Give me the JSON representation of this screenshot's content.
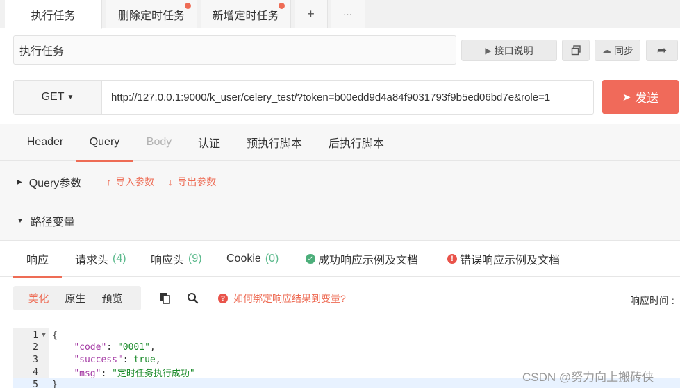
{
  "tabs": [
    {
      "label": "执行任务",
      "dot": false
    },
    {
      "label": "删除定时任务",
      "dot": true
    },
    {
      "label": "新增定时任务",
      "dot": true
    }
  ],
  "tab_add_glyph": "+",
  "tab_more_glyph": "···",
  "title_value": "执行任务",
  "toolbar": {
    "doc_label": "接口说明",
    "sync_label": "同步"
  },
  "request": {
    "method": "GET",
    "url": "http://127.0.0.1:9000/k_user/celery_test/?token=b00edd9d4a84f9031793f9b5ed06bd7e&role=1",
    "send_label": "发送"
  },
  "request_tabs": [
    "Header",
    "Query",
    "Body",
    "认证",
    "预执行脚本",
    "后执行脚本"
  ],
  "params": {
    "query_label": "Query参数",
    "import_label": "导入参数",
    "export_label": "导出参数",
    "path_label": "路径变量"
  },
  "response_tabs": {
    "response": "响应",
    "req_headers": "请求头",
    "req_headers_count": "(4)",
    "resp_headers": "响应头",
    "resp_headers_count": "(9)",
    "cookie": "Cookie",
    "cookie_count": "(0)",
    "success_doc": "成功响应示例及文档",
    "error_doc": "错误响应示例及文档"
  },
  "view_modes": [
    "美化",
    "原生",
    "预览"
  ],
  "bind_help": "如何绑定响应结果到变量?",
  "resp_time_label": "响应时间 :",
  "code_lines": [
    {
      "n": "1",
      "fold": true,
      "open": "{"
    },
    {
      "n": "2",
      "key": "\"code\"",
      "val": "\"0001\"",
      "tail": ","
    },
    {
      "n": "3",
      "key": "\"success\"",
      "val": "true",
      "tail": ","
    },
    {
      "n": "4",
      "key": "\"msg\"",
      "val": "\"定时任务执行成功\"",
      "tail": ""
    },
    {
      "n": "5",
      "close": "}"
    }
  ],
  "watermark": "CSDN @努力向上搬砖侠",
  "colors": {
    "accent": "#ee6c55",
    "send": "#f06a5a",
    "success": "#4cae7a",
    "error": "#e9534a"
  }
}
